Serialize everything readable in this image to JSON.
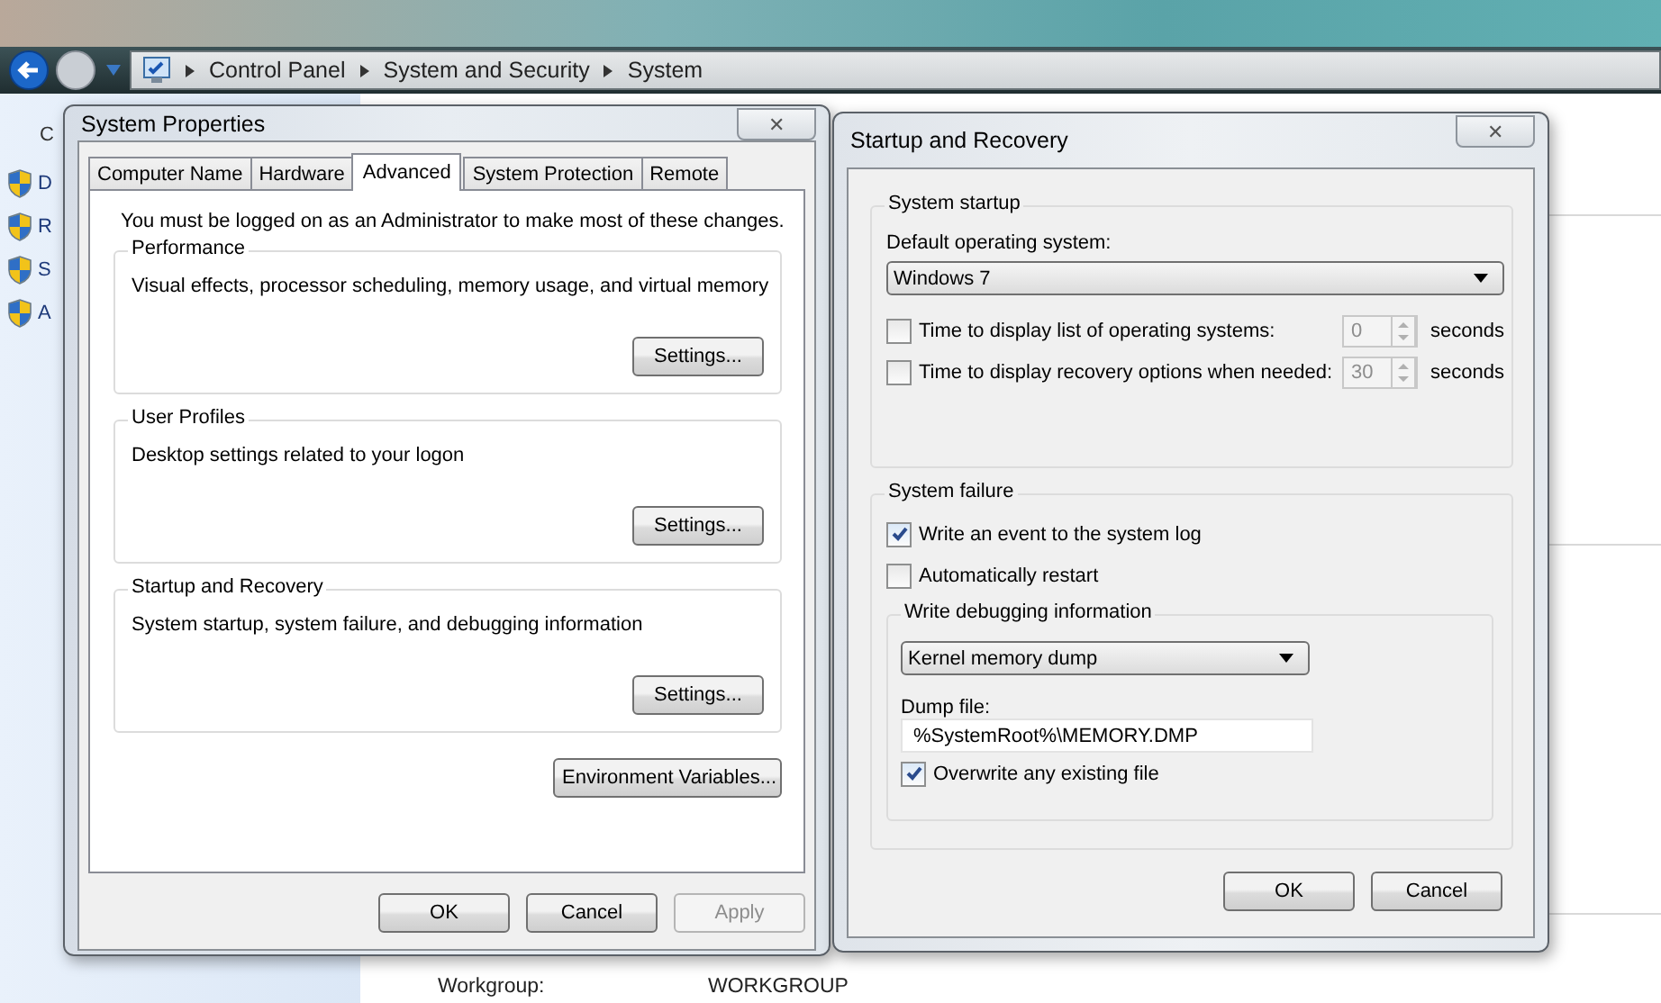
{
  "explorer": {
    "breadcrumb": [
      "Control Panel",
      "System and Security",
      "System"
    ],
    "sidebar": {
      "first_letter": "C",
      "items": [
        "D",
        "R",
        "S",
        "A"
      ]
    },
    "details": [
      {
        "label": "Workgroup:",
        "value": "WORKGROUP"
      }
    ]
  },
  "system_properties": {
    "title": "System Properties",
    "close": "✕",
    "tabs": [
      {
        "label": "Computer Name",
        "selected": false
      },
      {
        "label": "Hardware",
        "selected": false
      },
      {
        "label": "Advanced",
        "selected": true
      },
      {
        "label": "System Protection",
        "selected": false
      },
      {
        "label": "Remote",
        "selected": false
      }
    ],
    "notice": "You must be logged on as an Administrator to make most of these changes.",
    "groups": [
      {
        "title": "Performance",
        "description": "Visual effects, processor scheduling, memory usage, and virtual memory",
        "button": "Settings..."
      },
      {
        "title": "User Profiles",
        "description": "Desktop settings related to your logon",
        "button": "Settings..."
      },
      {
        "title": "Startup and Recovery",
        "description": "System startup, system failure, and debugging information",
        "button": "Settings..."
      }
    ],
    "environment_button": "Environment Variables...",
    "buttons": [
      {
        "label": "OK",
        "disabled": false
      },
      {
        "label": "Cancel",
        "disabled": false
      },
      {
        "label": "Apply",
        "disabled": true
      }
    ]
  },
  "startup_recovery": {
    "title": "Startup and Recovery",
    "close": "✕",
    "system_startup": {
      "title": "System startup",
      "default_os_label": "Default operating system:",
      "default_os": "Windows 7",
      "timers": [
        {
          "label": "Time to display list of operating systems:",
          "checked": false,
          "value": "0",
          "unit": "seconds"
        },
        {
          "label": "Time to display recovery options when needed:",
          "checked": false,
          "value": "30",
          "unit": "seconds"
        }
      ]
    },
    "system_failure": {
      "title": "System failure",
      "options": [
        {
          "label": "Write an event to the system log",
          "checked": true
        },
        {
          "label": "Automatically restart",
          "checked": false
        }
      ],
      "debugging": {
        "title": "Write debugging information",
        "dump_type": "Kernel memory dump",
        "dump_file_label": "Dump file:",
        "dump_file": "%SystemRoot%\\MEMORY.DMP",
        "overwrite": {
          "label": "Overwrite any existing file",
          "checked": true
        }
      }
    },
    "buttons": [
      {
        "label": "OK",
        "disabled": false
      },
      {
        "label": "Cancel",
        "disabled": false
      }
    ]
  }
}
